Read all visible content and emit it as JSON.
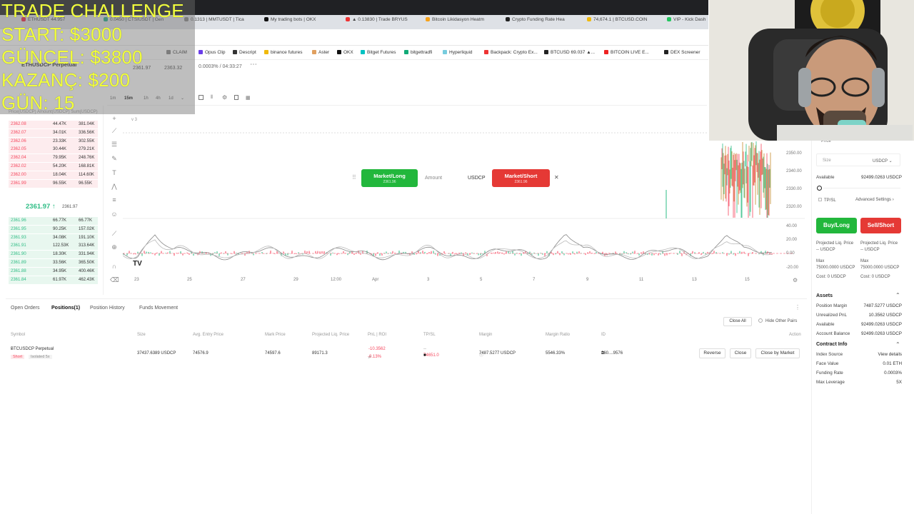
{
  "overlay": {
    "line1": "TRADE CHALLENGE",
    "line2": "START: $3000",
    "line3": "GÜNCEL: $3800",
    "line4": "KAZANÇ: $200",
    "line5": "GÜN: 15"
  },
  "browser_tabs": [
    {
      "label": "ETHUSDT 44.957",
      "color": "#e24"
    },
    {
      "label": "0.0450 | CTSIUSDT | Gen",
      "color": "#2a8"
    },
    {
      "label": "0.1313 | MMTUSDT | Tica",
      "color": "#888"
    },
    {
      "label": "My trading bots | OKX",
      "color": "#111"
    },
    {
      "label": "▲ 0.13830 | Trade BRYUS",
      "color": "#e33"
    },
    {
      "label": "Bitcoin Likidasyon Heatm",
      "color": "#f7a21a"
    },
    {
      "label": "Crypto Funding Rate Hea",
      "color": "#222"
    },
    {
      "label": "74,674.1 | BTCUSD.COIN",
      "color": "#f0b90b"
    },
    {
      "label": "VIP - Kick Dash",
      "color": "#22c55e"
    }
  ],
  "bookmarks": [
    {
      "label": "CLAIM",
      "color": "#888"
    },
    {
      "label": "Opus Clip",
      "color": "#6a3de8"
    },
    {
      "label": "Descript",
      "color": "#333"
    },
    {
      "label": "binance futures",
      "color": "#f0b90b"
    },
    {
      "label": "Aster",
      "color": "#e0a060"
    },
    {
      "label": "OKX",
      "color": "#111"
    },
    {
      "label": "Bitget Futures",
      "color": "#00c2c2"
    },
    {
      "label": "bitgettradfi",
      "color": "#1a7"
    },
    {
      "label": "Hyperliquid",
      "color": "#7cd"
    },
    {
      "label": "Backpack: Crypto Ex...",
      "color": "#e33"
    },
    {
      "label": "BTCUSD 69.037 ▲...",
      "color": "#222"
    },
    {
      "label": "BITCOIN LIVE E...",
      "color": "#e22"
    },
    {
      "label": "DEX Screener",
      "color": "#222"
    }
  ],
  "header": {
    "symbol": "ETHUSDCP Perpetual",
    "price_sub": "2361.97",
    "change": "2363.32",
    "funding": "0.0003% / 04:33:27",
    "more": "⋯"
  },
  "timeframes": [
    "1m",
    "15m",
    "1h",
    "4h",
    "1d"
  ],
  "orderbook": {
    "header": "Price(USDCP) Amount(USDCP) Sum(USDCP)",
    "asks": [
      {
        "price": "2362.08",
        "amount": "44.47K",
        "sum": "381.04K"
      },
      {
        "price": "2362.07",
        "amount": "34.01K",
        "sum": "336.56K"
      },
      {
        "price": "2362.06",
        "amount": "23.33K",
        "sum": "302.55K"
      },
      {
        "price": "2362.05",
        "amount": "30.44K",
        "sum": "279.21K"
      },
      {
        "price": "2362.04",
        "amount": "79.95K",
        "sum": "248.76K"
      },
      {
        "price": "2362.02",
        "amount": "54.20K",
        "sum": "168.81K"
      },
      {
        "price": "2362.00",
        "amount": "18.04K",
        "sum": "114.60K"
      },
      {
        "price": "2361.99",
        "amount": "96.55K",
        "sum": "96.55K"
      }
    ],
    "last_price": "2361.97",
    "last_arrow": "↑",
    "mark_price": "2361.97",
    "bids": [
      {
        "price": "2361.96",
        "amount": "66.77K",
        "sum": "66.77K"
      },
      {
        "price": "2361.95",
        "amount": "90.25K",
        "sum": "157.02K"
      },
      {
        "price": "2361.93",
        "amount": "34.08K",
        "sum": "191.10K"
      },
      {
        "price": "2361.91",
        "amount": "122.53K",
        "sum": "313.64K"
      },
      {
        "price": "2361.90",
        "amount": "18.30K",
        "sum": "331.94K"
      },
      {
        "price": "2361.89",
        "amount": "33.56K",
        "sum": "365.50K"
      },
      {
        "price": "2361.88",
        "amount": "34.95K",
        "sum": "400.46K"
      },
      {
        "price": "2361.84",
        "amount": "61.97K",
        "sum": "462.43K"
      }
    ]
  },
  "quick_trade": {
    "long_label": "Market/Long",
    "long_price": "2361.96",
    "amount_placeholder": "Amount",
    "currency": "USDCP",
    "short_label": "Market/Short",
    "short_price": "2361.96",
    "close": "✕"
  },
  "chart": {
    "y_labels": [
      "2350.00",
      "2340.00",
      "2330.00",
      "2320.00"
    ],
    "osc_labels": [
      "40.00",
      "20.00",
      "0.00",
      "-20.00"
    ],
    "x_labels": [
      "23",
      "25",
      "27",
      "29",
      "12:00",
      "Apr",
      "3",
      "5",
      "7",
      "9",
      "11",
      "13",
      "15"
    ],
    "indicator_tag": "3",
    "colors": {
      "up": "#2ebd85",
      "down": "#f6465d"
    }
  },
  "positions": {
    "tabs": [
      "Open Orders",
      "Positions(1)",
      "Position History",
      "Funds Movement"
    ],
    "close_all": "Close All",
    "hide_other": "Hide Other Pairs",
    "columns": [
      "Symbol",
      "Size",
      "Avg. Entry Price",
      "Mark Price",
      "Projected Liq. Price",
      "PnL | ROI",
      "TP/SL",
      "Margin",
      "Margin Ratio",
      "ID",
      "Action"
    ],
    "row": {
      "symbol": "BTCUSDCP Perpetual",
      "side": "Short",
      "mode": "Isolated 5x",
      "size": "37437.6389 USDCP",
      "entry": "74576.9",
      "mark": "74597.6",
      "liq": "89171.3",
      "pnl": "-10.3562",
      "roi": "-0.13%",
      "tpsl_top": "--",
      "tpsl": "74651.0",
      "margin": "7487.5277 USDCP",
      "margin_ratio": "5546.33%",
      "id": "260....9576",
      "btn_reverse": "Reverse",
      "btn_close": "Close",
      "btn_close_market": "Close by Market"
    }
  },
  "order_panel": {
    "price_label": "Price",
    "size_label": "Size",
    "size_unit": "USDCP",
    "available_label": "Available",
    "available_value": "92499.0263 USDCP",
    "tpsl": "TP/SL",
    "advanced": "Advanced Settings",
    "buy_label": "Buy/Long",
    "sell_label": "Sell/Short",
    "liq_label": "Projected Liq. Price",
    "liq_long": "-- USDCP",
    "liq_short": "-- USDCP",
    "max_label": "Max",
    "max_long": "75000.0000 USDCP",
    "max_short": "75000.0000 USDCP",
    "cost_long": "Cost: 0 USDCP",
    "cost_short": "Cost: 0 USDCP"
  },
  "assets": {
    "title": "Assets",
    "rows": [
      {
        "label": "Position Margin",
        "value": "7487.5277 USDCP"
      },
      {
        "label": "Unrealized PnL",
        "value": "10.3562 USDCP"
      },
      {
        "label": "Available",
        "value": "92499.0263 USDCP"
      },
      {
        "label": "Account Balance",
        "value": "92499.0263 USDCP"
      }
    ]
  },
  "contract_info": {
    "title": "Contract Info",
    "rows": [
      {
        "label": "Index Source",
        "value": "View details"
      },
      {
        "label": "Face Value",
        "value": "0.01 ETH"
      },
      {
        "label": "Funding Rate",
        "value": "0.0003%"
      },
      {
        "label": "Max Leverage",
        "value": "5X"
      }
    ]
  }
}
